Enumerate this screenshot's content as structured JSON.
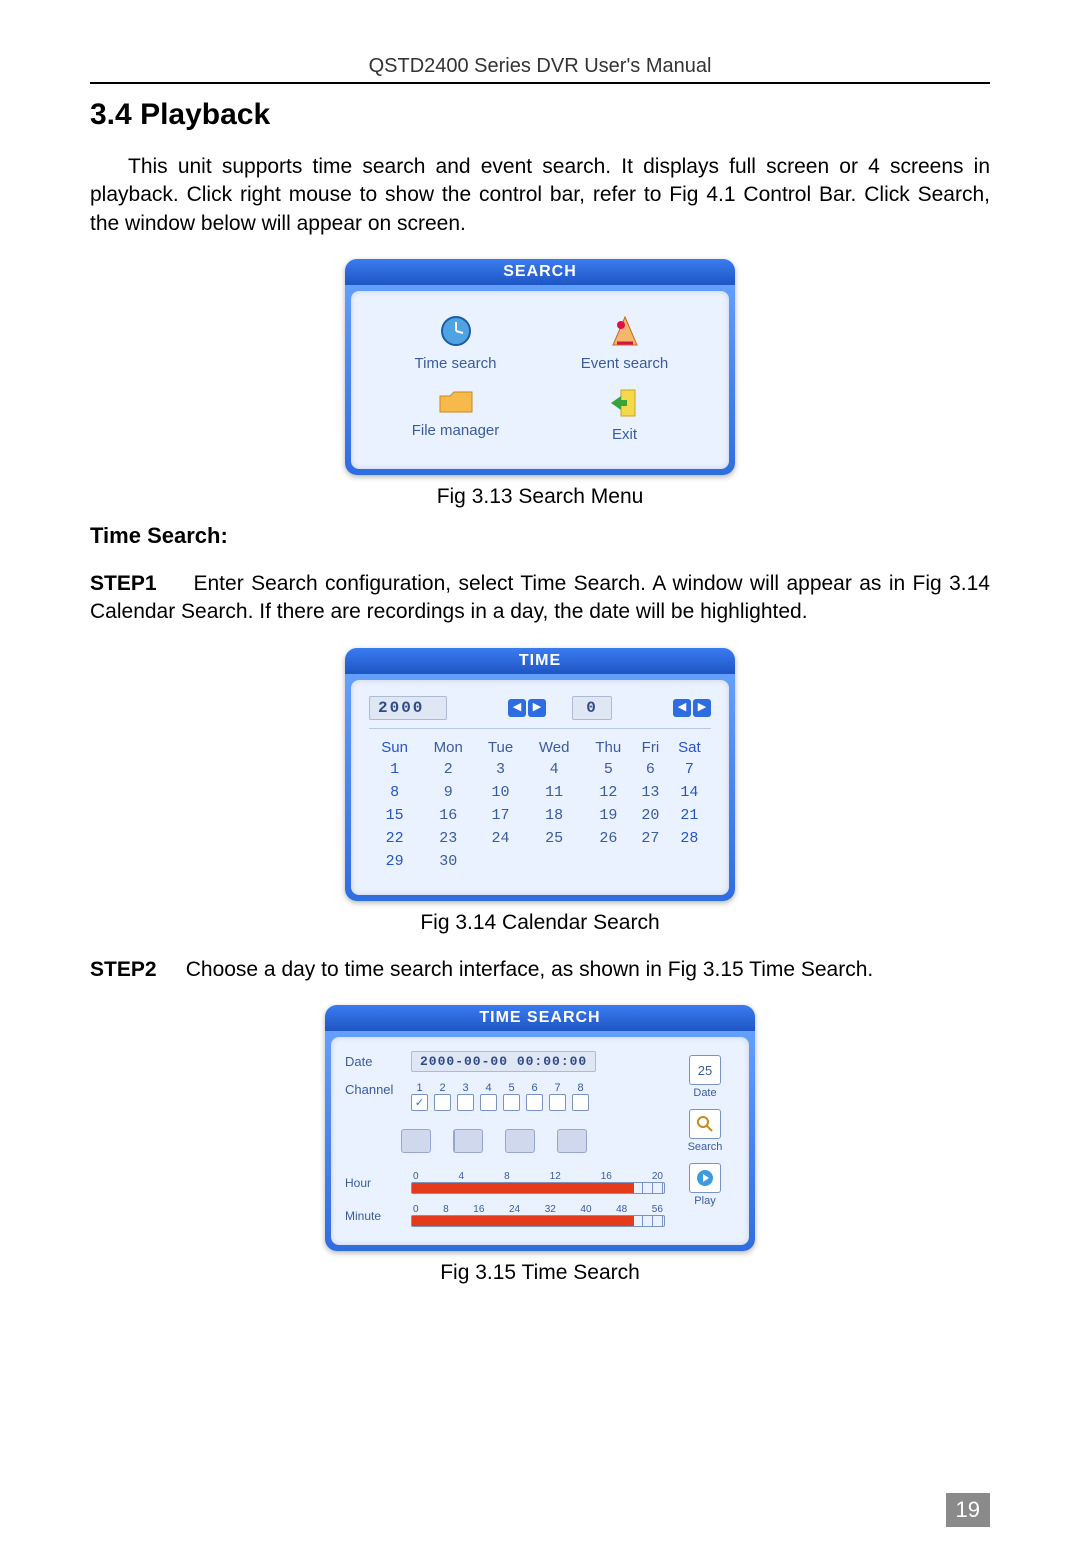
{
  "header": {
    "running": "QSTD2400 Series DVR User's Manual"
  },
  "section": {
    "number": "3.4",
    "title": "Playback",
    "intro": "This unit supports time search and event search. It displays full screen or 4 screens in playback. Click right mouse to show the control bar, refer to Fig 4.1 Control Bar. Click Search, the window below will appear on screen."
  },
  "search_menu": {
    "title": "SEARCH",
    "items": {
      "time_search": "Time search",
      "event_search": "Event search",
      "file_manager": "File manager",
      "exit": "Exit"
    },
    "caption": "Fig 3.13    Search Menu"
  },
  "time_search_section": {
    "heading": "Time Search:",
    "step1_label": "STEP1",
    "step1_text": "Enter Search configuration, select Time Search. A window will appear as in Fig 3.14 Calendar Search. If there are recordings in a day, the date will be highlighted."
  },
  "time_panel": {
    "title": "TIME",
    "year": "2000",
    "month": "0",
    "days": [
      "Sun",
      "Mon",
      "Tue",
      "Wed",
      "Thu",
      "Fri",
      "Sat"
    ],
    "weeks": [
      [
        "1",
        "2",
        "3",
        "4",
        "5",
        "6",
        "7"
      ],
      [
        "8",
        "9",
        "10",
        "11",
        "12",
        "13",
        "14"
      ],
      [
        "15",
        "16",
        "17",
        "18",
        "19",
        "20",
        "21"
      ],
      [
        "22",
        "23",
        "24",
        "25",
        "26",
        "27",
        "28"
      ],
      [
        "29",
        "30",
        "",
        "",
        "",
        "",
        ""
      ]
    ],
    "caption": "Fig 3.14 Calendar Search"
  },
  "step2": {
    "label": "STEP2",
    "text": "Choose a day to time search interface, as shown in Fig 3.15 Time Search."
  },
  "ts_panel": {
    "title": "TIME SEARCH",
    "date_label": "Date",
    "date_value": "2000-00-00 00:00:00",
    "channel_label": "Channel",
    "channels": [
      "1",
      "2",
      "3",
      "4",
      "5",
      "6",
      "7",
      "8"
    ],
    "channel_checked": 0,
    "hour_label": "Hour",
    "hour_ticks": [
      "0",
      "4",
      "8",
      "12",
      "16",
      "20"
    ],
    "hour_fill_pct": 88,
    "minute_label": "Minute",
    "minute_ticks": [
      "0",
      "8",
      "16",
      "24",
      "32",
      "40",
      "48",
      "56"
    ],
    "minute_fill_pct": 88,
    "side": {
      "date_btn": "Date",
      "date_value": "25",
      "search_btn": "Search",
      "play_btn": "Play"
    },
    "caption": "Fig 3.15 Time Search"
  },
  "page_number": "19"
}
